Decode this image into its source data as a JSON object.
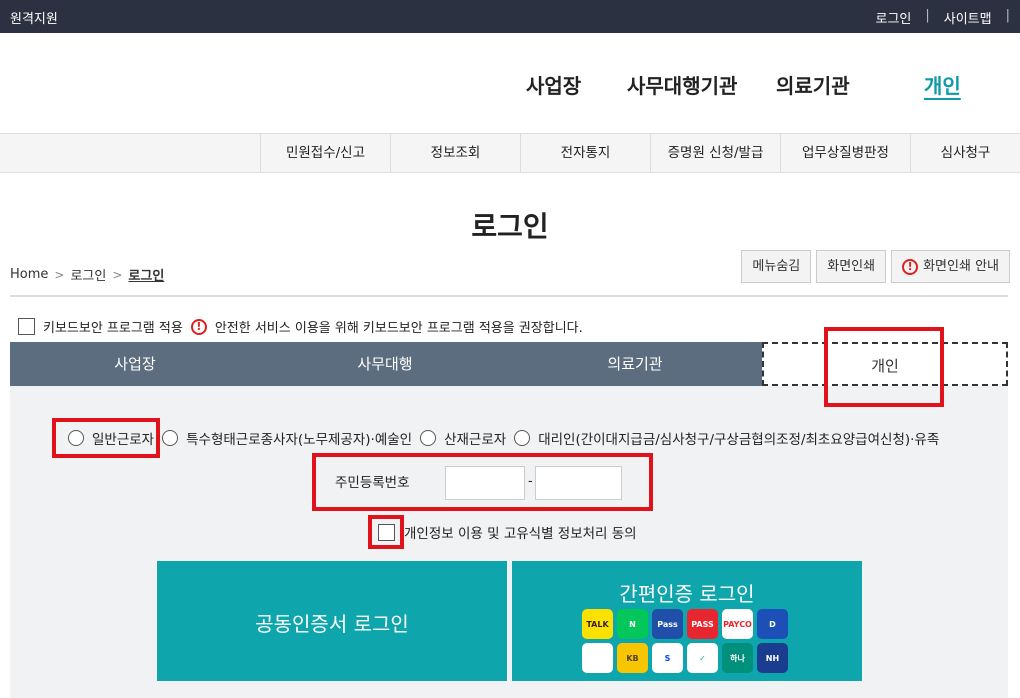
{
  "topbar": {
    "title": "원격지원",
    "login": "로그인",
    "sitemap": "사이트맵",
    "sep": "|"
  },
  "gnb": [
    "사업장",
    "사무대행기관",
    "의료기관",
    "개인"
  ],
  "lnb": [
    "민원접수/신고",
    "정보조회",
    "전자통지",
    "증명원 신청/발급",
    "업무상질병판정",
    "심사청구"
  ],
  "page_title": "로그인",
  "breadcrumb": {
    "home": "Home",
    "level1": "로그인",
    "current": "로그인",
    "chev": ">"
  },
  "util_buttons": {
    "hide_menu": "메뉴숨김",
    "print": "화면인쇄",
    "print_guide": "화면인쇄 안내"
  },
  "keyboard": {
    "label": "키보드보안 프로그램 적용",
    "notice": "안전한 서비스 이용을 위해 키보드보안 프로그램 적용을 권장합니다."
  },
  "tabs": [
    "사업장",
    "사무대행",
    "의료기관",
    "개인"
  ],
  "radios": [
    "일반근로자",
    "특수형태근로종사자(노무제공자)·예술인",
    "산재근로자",
    "대리인(간이대지급금/심사청구/구상금협의조정/최초요양급여신청)·유족"
  ],
  "rrn": {
    "label": "주민등록번호",
    "dash": "-"
  },
  "agree_label": "개인정보 이용 및 고유식별 정보처리 동의",
  "cert_login": "공동인증서 로그인",
  "simple_login": "간편인증 로그인",
  "apps": [
    {
      "name": "kakao-icon",
      "text": "TALK",
      "bg": "#fae100",
      "fg": "#3a1d1d"
    },
    {
      "name": "naver-icon",
      "text": "N",
      "bg": "#03c75a",
      "fg": "#ffffff"
    },
    {
      "name": "samsung-pass-icon",
      "text": "Pass",
      "bg": "#1f4fa8",
      "fg": "#ffffff"
    },
    {
      "name": "pass-icon",
      "text": "PASS",
      "bg": "#e8262f",
      "fg": "#ffffff"
    },
    {
      "name": "payco-icon",
      "text": "PAYCO",
      "bg": "#ffffff",
      "fg": "#e8262f"
    },
    {
      "name": "dream-icon",
      "text": "D",
      "bg": "#1d4fb8",
      "fg": "#ffffff"
    },
    {
      "name": "toss-icon",
      "text": "",
      "bg": "#ffffff",
      "fg": "#1e73e8"
    },
    {
      "name": "kb-icon",
      "text": "KB",
      "bg": "#f7c600",
      "fg": "#4e4036"
    },
    {
      "name": "shinhan-icon",
      "text": "S",
      "bg": "#ffffff",
      "fg": "#0046ff"
    },
    {
      "name": "woori-icon",
      "text": "✓",
      "bg": "#ffffff",
      "fg": "#1cb67e"
    },
    {
      "name": "hana-icon",
      "text": "하나",
      "bg": "#00907b",
      "fg": "#ffffff"
    },
    {
      "name": "nh-icon",
      "text": "NH",
      "bg": "#1b3d8f",
      "fg": "#ffffff"
    }
  ]
}
